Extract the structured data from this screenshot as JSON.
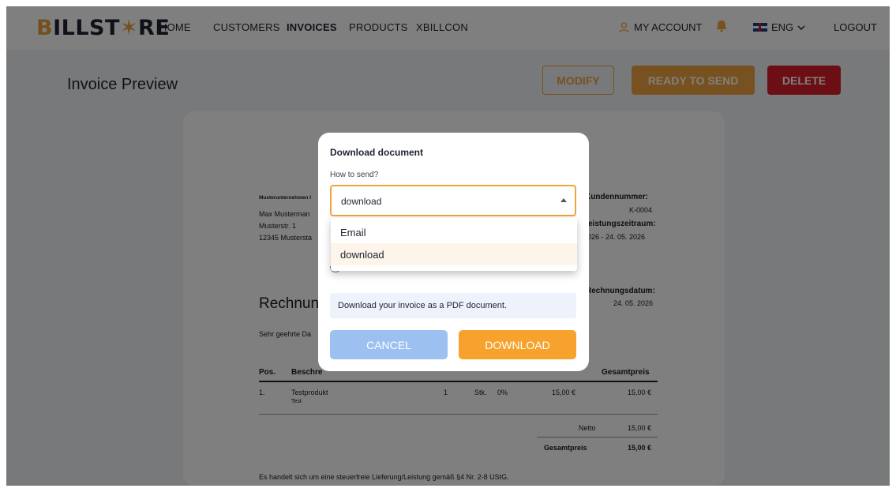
{
  "brand": {
    "logo_text": "BILLSTORE"
  },
  "nav": {
    "home": "HOME",
    "customers": "CUSTOMERS",
    "invoices": "INVOICES",
    "products": "PRODUCTS",
    "xbillcon": "XBILLCON",
    "my_account": "MY ACCOUNT",
    "language": "ENG",
    "logout": "LOGOUT"
  },
  "page": {
    "title": "Invoice Preview",
    "modify": "MODIFY",
    "ready_to_send": "READY TO SEND",
    "delete": "DELETE"
  },
  "invoice": {
    "sender_line": "Musterunternehmen I",
    "recipient_name": "Max Musterman",
    "recipient_street": "Musterstr. 1",
    "recipient_city": "12345 Mustersta",
    "customer_number_label": "Kundennummer:",
    "customer_number": "K-0004",
    "period_label": "eistungszeitraum:",
    "period_value": "026  -  24. 05. 2026",
    "heading": "Rechnung",
    "date_label": "Rechnungsdatum:",
    "date_value": "24. 05. 2026",
    "salutation": "Sehr geehrte Da",
    "table": {
      "headers": {
        "pos": "Pos.",
        "desc": "Beschre",
        "total": "Gesamtpreis"
      },
      "row": {
        "pos": "1.",
        "name": "Testprodukt",
        "sub": "Test",
        "qty": "1",
        "unit": "Stk.",
        "tax": "0%",
        "price": "15,00 €",
        "total": "15,00 €"
      }
    },
    "netto_label": "Netto",
    "netto_value": "15,00 €",
    "gesamt_label": "Gesamtpreis",
    "gesamt_value": "15,00 €",
    "footer": "Es handelt sich um eine steuerfreie Lieferung/Leistung gemäß §4 Nr. 2-8 UStG."
  },
  "modal": {
    "title": "Download document",
    "how_label": "How to send?",
    "selected": "download",
    "options": [
      "Email",
      "download"
    ],
    "info": "Download your invoice as a PDF document.",
    "cancel": "CANCEL",
    "download": "DOWNLOAD"
  },
  "colors": {
    "accent": "#f0a340",
    "danger": "#d91f2a",
    "cancel": "#9cc0f0"
  }
}
